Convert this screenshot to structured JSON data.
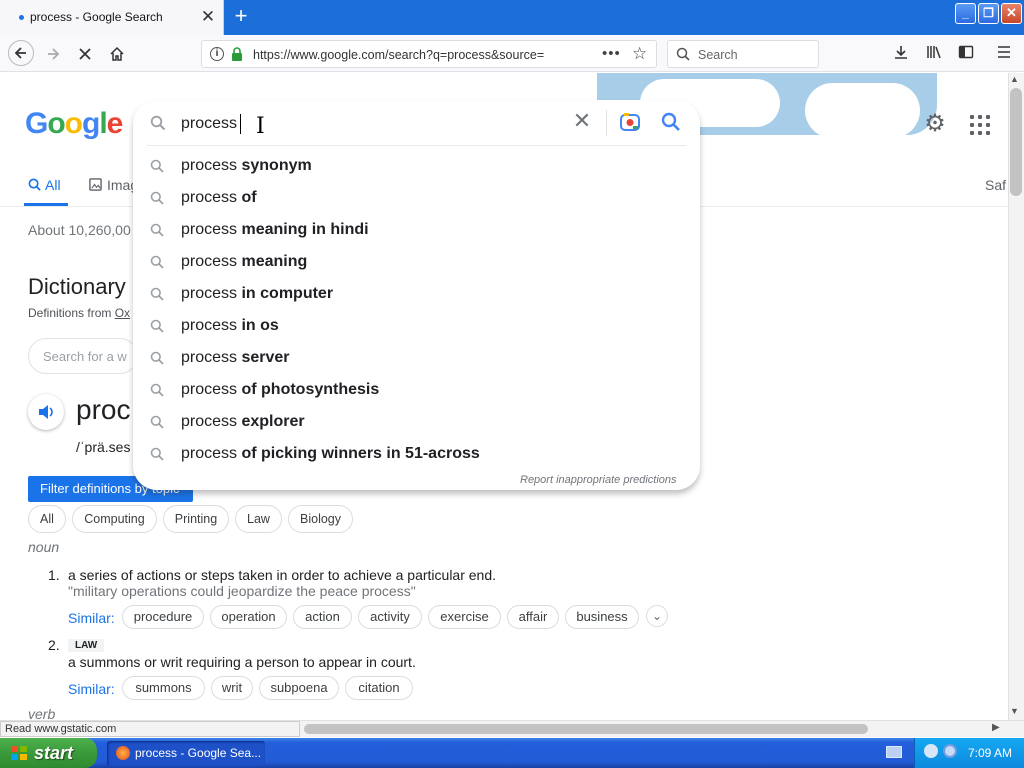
{
  "browser": {
    "tab_title": "process - Google Search",
    "tab_close": "✕",
    "new_tab": "+",
    "window_buttons": {
      "minimize": "_",
      "maximize": "❐",
      "close": "✕"
    },
    "url": "https://www.google.com/search?q=process&source=",
    "url_info": "i",
    "search_placeholder": "Search",
    "status_text": "Read www.gstatic.com"
  },
  "google": {
    "logo_letters": [
      "G",
      "o",
      "o",
      "g",
      "l",
      "e"
    ],
    "tabs": {
      "all": "All",
      "images": "Imag",
      "safe": "Saf"
    },
    "results_count": "About 10,260,00"
  },
  "search_box": {
    "query": "process",
    "suggestions": [
      {
        "prefix": "process",
        "completion": "synonym"
      },
      {
        "prefix": "process",
        "completion": "of"
      },
      {
        "prefix": "process",
        "completion": "meaning in hindi"
      },
      {
        "prefix": "process",
        "completion": "meaning"
      },
      {
        "prefix": "process",
        "completion": "in computer"
      },
      {
        "prefix": "process",
        "completion": "in os"
      },
      {
        "prefix": "process",
        "completion": "server"
      },
      {
        "prefix": "process",
        "completion": "of photosynthesis"
      },
      {
        "prefix": "process",
        "completion": "explorer"
      },
      {
        "prefix": "process",
        "completion": "of picking winners in 51-across"
      }
    ],
    "report_link": "Report inappropriate predictions"
  },
  "dictionary": {
    "heading": "Dictionary",
    "source_prefix": "Definitions from ",
    "source_link": "Ox",
    "search_placeholder": "Search for a w",
    "word": "proc",
    "phonetic": "/ˈprä.ses",
    "filter_button": "Filter definitions by topic",
    "topic_chips": [
      "All",
      "Computing",
      "Printing",
      "Law",
      "Biology"
    ],
    "pos_noun": "noun",
    "def1": {
      "num": "1.",
      "text": "a series of actions or steps taken in order to achieve a particular end.",
      "example": "\"military operations could jeopardize the peace process\"",
      "similar_label": "Similar:",
      "similar": [
        "procedure",
        "operation",
        "action",
        "activity",
        "exercise",
        "affair",
        "business"
      ]
    },
    "def2": {
      "num": "2.",
      "label": "LAW",
      "text": "a summons or writ requiring a person to appear in court.",
      "similar_label": "Similar:",
      "similar": [
        "summons",
        "writ",
        "subpoena",
        "citation"
      ]
    },
    "pos_verb": "verb"
  },
  "taskbar": {
    "start_label": "start",
    "task_label": "process - Google Sea...",
    "clock": "7:09 AM"
  },
  "colors": {
    "accent": "#1a73e8",
    "title_bar": "#1c6ed8",
    "taskbar": "#245edb",
    "start_green": "#3a9a3a"
  }
}
